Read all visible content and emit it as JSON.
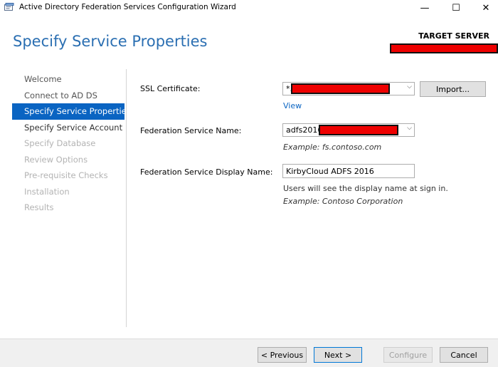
{
  "window": {
    "title": "Active Directory Federation Services Configuration Wizard",
    "minimize_glyph": "—",
    "maximize_glyph": "☐",
    "close_glyph": "✕"
  },
  "header": {
    "page_title": "Specify Service Properties",
    "target_server_label": "TARGET SERVER"
  },
  "nav": {
    "items": [
      {
        "label": "Welcome",
        "state": "done"
      },
      {
        "label": "Connect to AD DS",
        "state": "done"
      },
      {
        "label": "Specify Service Properties",
        "state": "active"
      },
      {
        "label": "Specify Service Account",
        "state": "pending"
      },
      {
        "label": "Specify Database",
        "state": "disabled"
      },
      {
        "label": "Review Options",
        "state": "disabled"
      },
      {
        "label": "Pre-requisite Checks",
        "state": "disabled"
      },
      {
        "label": "Installation",
        "state": "disabled"
      },
      {
        "label": "Results",
        "state": "disabled"
      }
    ]
  },
  "form": {
    "ssl_label": "SSL Certificate:",
    "ssl_value": "*.",
    "import_button": "Import...",
    "view_link": "View",
    "fs_name_label": "Federation Service Name:",
    "fs_name_value": "adfs2016.",
    "fs_name_example": "Example: fs.contoso.com",
    "display_name_label": "Federation Service Display Name:",
    "display_name_value": "KirbyCloud ADFS 2016",
    "display_name_note": "Users will see the display name at sign in.",
    "display_name_example": "Example: Contoso Corporation"
  },
  "footer": {
    "previous": "< Previous",
    "next": "Next >",
    "configure": "Configure",
    "cancel": "Cancel"
  },
  "colors": {
    "accent": "#0a64c2",
    "title_blue": "#2b6fb2",
    "redaction": "#ee0000"
  },
  "icons": {
    "app": "server-wizard-icon",
    "dropdown": "chevron-down-icon"
  }
}
